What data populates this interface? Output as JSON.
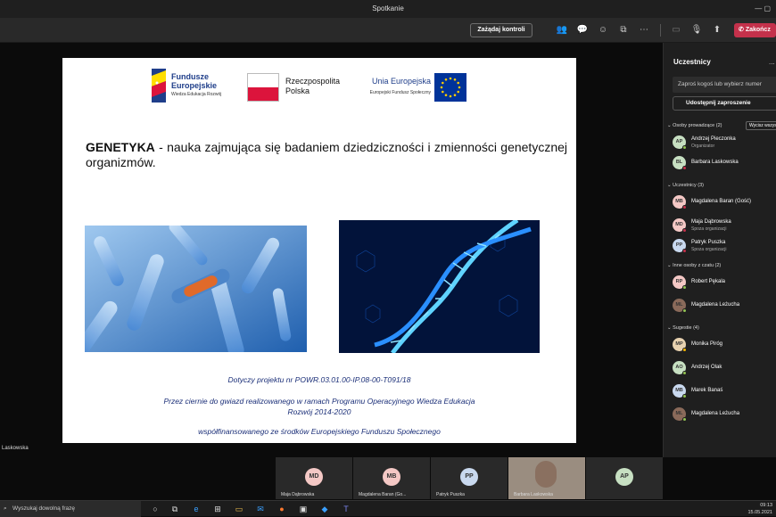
{
  "window": {
    "title": "Spotkanie"
  },
  "toolbar": {
    "request_control": "Zażądaj kontroli",
    "end_call": "Zakończ",
    "icons": [
      "people-icon",
      "chat-icon",
      "reactions-icon",
      "share-icon",
      "more-icon",
      "camera-icon",
      "mic-icon",
      "share-tray-icon",
      "phone-icon"
    ]
  },
  "slide": {
    "logo_fe_line1": "Fundusze",
    "logo_fe_line2": "Europejskie",
    "logo_fe_sub": "Wiedza Edukacja Rozwój",
    "logo_pl_line1": "Rzeczpospolita",
    "logo_pl_line2": "Polska",
    "logo_eu_line1": "Unia Europejska",
    "logo_eu_sub": "Europejski Fundusz Społeczny",
    "heading_bold": "GENETYKA",
    "heading_rest": " - nauka zajmująca się badaniem dziedziczności i zmienności genetycznej organizmów.",
    "footer_1": "Dotyczy projektu nr POWR.03.01.00-IP.08-00-T091/18",
    "footer_2": "Przez ciernie do gwiazd realizowanego w ramach Programu Operacyjnego Wiedza Edukacja",
    "footer_3": "Rozwój 2014-2020",
    "footer_4": "współfinansowanego ze środków Europejskiego Funduszu Społecznego"
  },
  "presenter_name": "Laskowska",
  "side": {
    "title": "Uczestnicy",
    "more": "...",
    "invite_placeholder": "Zaproś kogoś lub wybierz numer",
    "share_invite": "Udostępnij zaproszenie",
    "mute_all": "Wycisz wszystkich",
    "sections": [
      {
        "label": "Osoby prowadzące (2)",
        "people": [
          {
            "initials": "AP",
            "name": "Andrzej Pieczonka",
            "sub": "Organizator",
            "color": "#c7e0c2",
            "status": "#92c353"
          },
          {
            "initials": "BL",
            "name": "Barbara Laskowska",
            "sub": "",
            "color": "#c7e0c2",
            "status": "#c4314b"
          }
        ]
      },
      {
        "label": "Uczestnicy (3)",
        "people": [
          {
            "initials": "MB",
            "name": "Magdalena Baran (Gość)",
            "sub": "",
            "color": "#f4c8c5",
            "status": "#c4314b"
          },
          {
            "initials": "MD",
            "name": "Maja Dąbrowska",
            "sub": "Spoza organizacji",
            "color": "#f4c8c5",
            "status": "#c4314b"
          },
          {
            "initials": "PP",
            "name": "Patryk Puszka",
            "sub": "Spoza organizacji",
            "color": "#c9d9ef",
            "status": "#c4314b"
          }
        ]
      },
      {
        "label": "Inne osoby z czatu (2)",
        "people": [
          {
            "initials": "RP",
            "name": "Robert Pękala",
            "sub": "",
            "color": "#f4c8c5",
            "status": "#92c353"
          },
          {
            "initials": "ML",
            "name": "Magdalena Leżucha",
            "sub": "",
            "color": "#8a6a5a",
            "status": "#92c353"
          }
        ]
      },
      {
        "label": "Sugestie (4)",
        "people": [
          {
            "initials": "MP",
            "name": "Monika Piróg",
            "sub": "",
            "color": "#e8d2b0",
            "status": "#f8b800"
          },
          {
            "initials": "AO",
            "name": "Andrzej Olak",
            "sub": "",
            "color": "#c7e0c2",
            "status": "#92c353"
          },
          {
            "initials": "MB",
            "name": "Marek Banaś",
            "sub": "",
            "color": "#c9d9ef",
            "status": "#92c353"
          },
          {
            "initials": "ML",
            "name": "Magdalena Leżucha",
            "sub": "",
            "color": "#8a6a5a",
            "status": "#92c353"
          }
        ]
      }
    ]
  },
  "tiles": [
    {
      "initials": "MD",
      "name": "Maja Dąbrowska",
      "color": "#f4c8c5"
    },
    {
      "initials": "MB",
      "name": "Magdalena Baran (Go...",
      "color": "#f4c8c5"
    },
    {
      "initials": "PP",
      "name": "Patryk Puszka",
      "color": "#c9d9ef"
    },
    {
      "initials": "",
      "name": "Barbara Laskowska",
      "color": "#8a7060"
    },
    {
      "initials": "AP",
      "name": "",
      "color": "#c7e0c2"
    }
  ],
  "taskbar": {
    "search_placeholder": "Wyszukaj dowolną frazę",
    "time": "09:13",
    "date": "15.05.2021"
  },
  "colors": {
    "accent_end": "#c4314b",
    "slide_blue": "#1b2f78"
  }
}
